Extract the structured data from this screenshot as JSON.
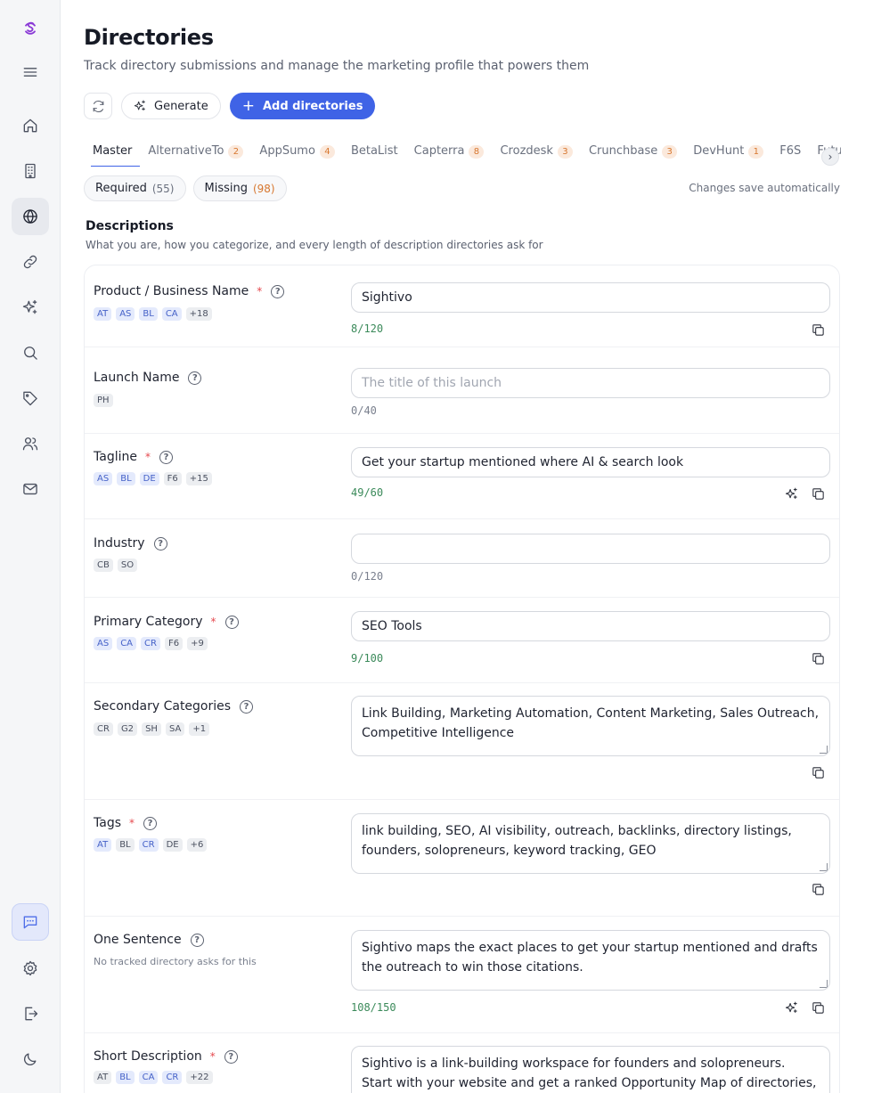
{
  "page": {
    "title": "Directories",
    "subtitle": "Track directory submissions and manage the marketing profile that powers them"
  },
  "toolbar": {
    "generate_label": "Generate",
    "add_label": "Add directories"
  },
  "tabs": [
    {
      "label": "Master",
      "count": "",
      "active": true
    },
    {
      "label": "AlternativeTo",
      "count": "2"
    },
    {
      "label": "AppSumo",
      "count": "4"
    },
    {
      "label": "BetaList",
      "count": ""
    },
    {
      "label": "Capterra",
      "count": "8"
    },
    {
      "label": "Crozdesk",
      "count": "3"
    },
    {
      "label": "Crunchbase",
      "count": "3"
    },
    {
      "label": "DevHunt",
      "count": "1"
    },
    {
      "label": "F6S",
      "count": ""
    },
    {
      "label": "Future",
      "count": ""
    }
  ],
  "filters": {
    "required_label": "Required",
    "required_count": "(55)",
    "missing_label": "Missing",
    "missing_count": "(98)",
    "autosave": "Changes save automatically"
  },
  "section": {
    "title": "Descriptions",
    "subtitle": "What you are, how you categorize, and every length of description directories ask for"
  },
  "fields": {
    "product_name": {
      "label": "Product / Business Name",
      "required": "*",
      "badges": [
        "AT",
        "AS",
        "BL",
        "CA",
        "+18"
      ],
      "value": "Sightivo",
      "counter": "8/120"
    },
    "launch_name": {
      "label": "Launch Name",
      "badges": [
        "PH"
      ],
      "placeholder": "The title of this launch",
      "counter": "0/40"
    },
    "tagline": {
      "label": "Tagline",
      "required": "*",
      "badges": [
        "AS",
        "BL",
        "DE",
        "F6",
        "+15"
      ],
      "value": "Get your startup mentioned where AI & search look",
      "counter": "49/60"
    },
    "industry": {
      "label": "Industry",
      "badges": [
        "CB",
        "SO"
      ],
      "value": "",
      "counter": "0/120"
    },
    "primary_category": {
      "label": "Primary Category",
      "required": "*",
      "badges": [
        "AS",
        "CA",
        "CR",
        "F6",
        "+9"
      ],
      "value": "SEO Tools",
      "counter": "9/100"
    },
    "secondary_categories": {
      "label": "Secondary Categories",
      "badges": [
        "CR",
        "G2",
        "SH",
        "SA",
        "+1"
      ],
      "value": "Link Building, Marketing Automation, Content Marketing, Sales Outreach, Competitive Intelligence"
    },
    "tags": {
      "label": "Tags",
      "required": "*",
      "badges": [
        "AT",
        "BL",
        "CR",
        "DE",
        "+6"
      ],
      "value": "link building, SEO, AI visibility, outreach, backlinks, directory listings, founders, solopreneurs, keyword tracking, GEO"
    },
    "one_sentence": {
      "label": "One Sentence",
      "note": "No tracked directory asks for this",
      "value": "Sightivo maps the exact places to get your startup mentioned and drafts the outreach to win those citations.",
      "counter": "108/150"
    },
    "short_description": {
      "label": "Short Description",
      "required": "*",
      "badges": [
        "AT",
        "BL",
        "CA",
        "CR",
        "+22"
      ],
      "value": "Sightivo is a link-building workspace for founders and solopreneurs. Start with your website and get a ranked Opportunity Map of directories, articles,"
    }
  },
  "icons": {
    "accent": "#3f63e6",
    "warn": "#d7772f",
    "counter_ok": "#3b8a5a"
  }
}
